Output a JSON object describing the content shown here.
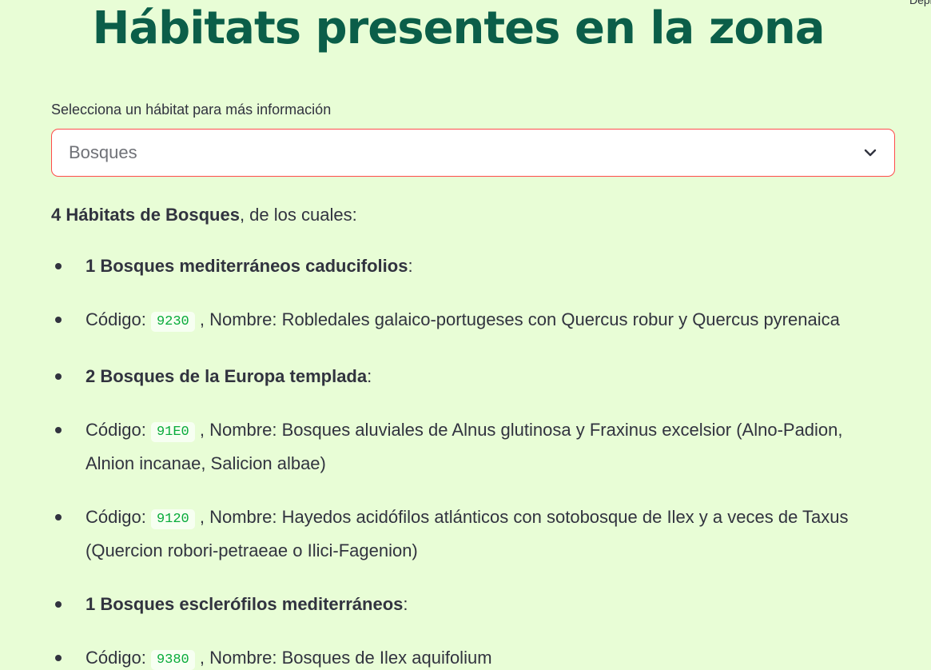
{
  "header": {
    "deploy_label": "Deploy",
    "title": "Hábitats presentes en la zona"
  },
  "selector": {
    "label": "Selecciona un hábitat para más información",
    "value": "Bosques"
  },
  "summary": {
    "bold": "4 Hábitats de Bosques",
    "rest": ", de los cuales:"
  },
  "list": {
    "code_prefix": "Código: ",
    "name_prefix": " , Nombre: ",
    "group1": {
      "label": "1 Bosques mediterráneos caducifolios",
      "suffix": ":"
    },
    "item1": {
      "code": "9230",
      "name": "Robledales galaico-portugeses con Quercus robur y Quercus pyrenaica"
    },
    "group2": {
      "label": "2 Bosques de la Europa templada",
      "suffix": ":"
    },
    "item2": {
      "code": "91E0",
      "name": "Bosques aluviales de Alnus glutinosa y Fraxinus excelsior (Alno-Padion, Alnion incanae, Salicion albae)"
    },
    "item3": {
      "code": "9120",
      "name": "Hayedos acidófilos atlánticos con sotobosque de Ilex y a veces de Taxus (Quercion robori-petraeae o Ilici-Fagenion)"
    },
    "group3": {
      "label": "1 Bosques esclerófilos mediterráneos",
      "suffix": ":"
    },
    "item4": {
      "code": "9380",
      "name": "Bosques de Ilex aquifolium"
    }
  },
  "colors": {
    "background": "#e8fdd6",
    "title": "#0b5e49",
    "code_text": "#09ab3b",
    "focus_border": "#ff4b4b"
  },
  "icons": {
    "dropdown": "chevron-down-icon"
  }
}
